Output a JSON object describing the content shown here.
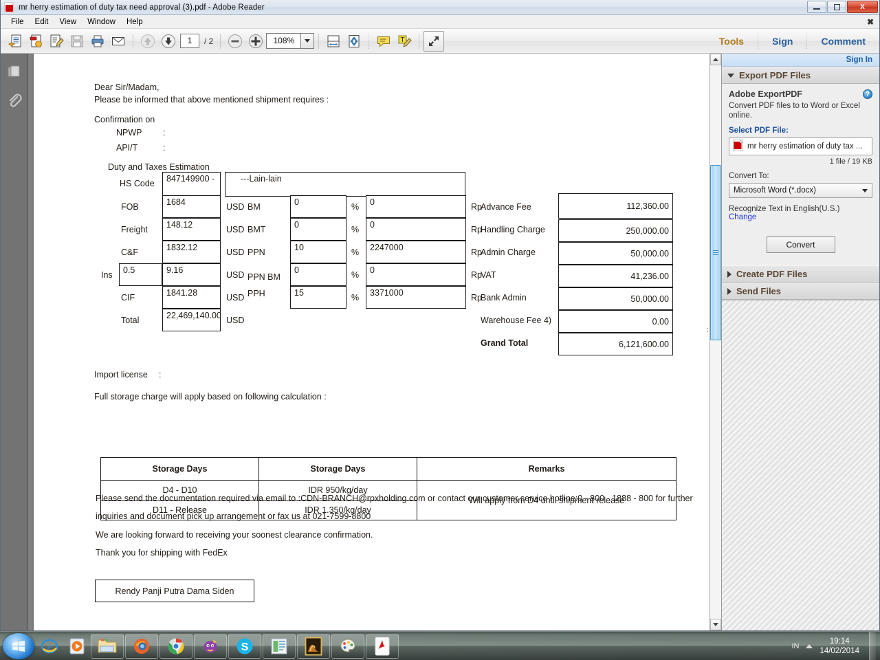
{
  "window": {
    "title": "mr herry estimation of duty tax need approval (3).pdf - Adobe Reader",
    "app_icon": "pdf-icon",
    "minimize_label": "Minimize",
    "restore_label": "Restore",
    "close_label": "X"
  },
  "menubar": {
    "items": [
      "File",
      "Edit",
      "View",
      "Window",
      "Help"
    ],
    "close_doc_label": "✖"
  },
  "toolbar": {
    "icons": [
      {
        "name": "open-file-icon",
        "glyph": "open"
      },
      {
        "name": "create-pdf-icon",
        "glyph": "create"
      },
      {
        "name": "edit-pdf-icon",
        "glyph": "edit"
      },
      {
        "name": "save-icon",
        "glyph": "save"
      },
      {
        "name": "print-icon",
        "glyph": "print"
      },
      {
        "name": "email-icon",
        "glyph": "email"
      }
    ],
    "prev_page_label": "Previous page",
    "next_page_label": "Next page",
    "page_number": "1",
    "page_total": "/ 2",
    "zoom_out_label": "Zoom out",
    "zoom_in_label": "Zoom in",
    "zoom_value": "108%",
    "fit_width_label": "Fit width",
    "fit_page_label": "Fit page",
    "comment_icon_label": "Sticky note",
    "highlight_icon_label": "Highlight text",
    "fullscreen_label": "Read mode",
    "tools_label": "Tools",
    "sign_label": "Sign",
    "comment_label": "Comment"
  },
  "left_nav": {
    "pages_label": "Page Thumbnails",
    "attachments_label": "Attachments"
  },
  "document": {
    "salutation": "Dear Sir/Madam,",
    "intro": "Please be informed that above mentioned shipment requires :",
    "confirmation_heading": "Confirmation on",
    "confirmation_rows": [
      {
        "label": "NPWP",
        "colon": ":",
        "value": ""
      },
      {
        "label": "API/T",
        "colon": ":",
        "value": ""
      }
    ],
    "duty_heading": "Duty and Taxes Estimation",
    "hs_code_label": "HS Code",
    "hs_code_value": "847149900 -",
    "hs_code_desc": "---Lain-lain",
    "left_rows": [
      {
        "label": "FOB",
        "value": "1684",
        "unit": "USD"
      },
      {
        "label": "Freight",
        "value": "148.12",
        "unit": "USD"
      },
      {
        "label": "C&F",
        "value": "1832.12",
        "unit": "USD"
      },
      {
        "label": "0.5",
        "value": "9.16",
        "unit": "USD",
        "prefix": "Ins"
      },
      {
        "label": "CIF",
        "value": "1841.28",
        "unit": "USD"
      },
      {
        "label": "Total",
        "value": "22,469,140.00",
        "unit": "USD"
      }
    ],
    "tax_rows": [
      {
        "label": "BM",
        "percent": "0",
        "pct_sym": "%",
        "amount": "0",
        "currency": "Rp"
      },
      {
        "label": "BMT",
        "percent": "0",
        "pct_sym": "%",
        "amount": "0",
        "currency": "Rp"
      },
      {
        "label": "PPN",
        "percent": "10",
        "pct_sym": "%",
        "amount": "2247000",
        "currency": "Rp"
      },
      {
        "label": "PPN BM",
        "percent": "0",
        "pct_sym": "%",
        "amount": "0",
        "currency": "Rp"
      },
      {
        "label": "PPH",
        "percent": "15",
        "pct_sym": "%",
        "amount": "3371000",
        "currency": "Rp"
      }
    ],
    "fee_rows": [
      {
        "label": "Advance Fee",
        "value": "112,360.00"
      },
      {
        "label": "Handling Charge",
        "value": "250,000.00"
      },
      {
        "label": "Admin Charge",
        "value": "50,000.00"
      },
      {
        "label": "VAT",
        "value": "41,236.00"
      },
      {
        "label": "Bank Admin",
        "value": "50,000.00"
      },
      {
        "label": "Warehouse Fee 4)",
        "value": "0.00"
      },
      {
        "label": "Grand Total",
        "value": "6,121,600.00",
        "bold": true
      }
    ],
    "stray_colon": ":",
    "import_license_label": "Import license",
    "import_license_colon": ":",
    "storage_intro": "Full storage charge will apply based on following calculation :",
    "storage_table": {
      "headers": [
        "Storage Days",
        "Storage Days",
        "Remarks"
      ],
      "rows": [
        {
          "days": "D4 - D10",
          "rate": "IDR 950/kg/day"
        },
        {
          "days": "D11 - Release",
          "rate": "IDR 1.350/kg/day"
        }
      ],
      "remarks": "Will apply from D4 until shipment release"
    },
    "closing_lines": [
      "Please send the documentation required via email to :CDN-BRANCH@rpxholding.com or contact our customer service hotline:0 - 800 - 1888 - 800 for further",
      "inquiries and document pick up arrangement or fax us at 021-7599-8800",
      "We are looking forward to receiving your soonest clearance confirmation.",
      "Thank you for shipping with FedEx"
    ],
    "signature_name": "Rendy Panji Putra Dama Siden"
  },
  "right_panel": {
    "sign_in_label": "Sign In",
    "sections": [
      {
        "title": "Export PDF Files",
        "expanded": true
      },
      {
        "title": "Create PDF Files",
        "expanded": false
      },
      {
        "title": "Send Files",
        "expanded": false
      }
    ],
    "export": {
      "product_title": "Adobe ExportPDF",
      "help_glyph": "?",
      "description": "Convert PDF files to to Word or Excel online.",
      "select_file_label": "Select PDF File:",
      "file_name": "mr herry estimation of duty tax ...",
      "file_meta": "1 file / 19 KB",
      "convert_to_label": "Convert To:",
      "convert_to_value": "Microsoft Word (*.docx)",
      "recognize_text": "Recognize Text in English(U.S.)",
      "change_link": "Change",
      "convert_button": "Convert"
    }
  },
  "scrollbar": {
    "up_label": "Scroll up",
    "down_label": "Scroll down",
    "thumb_label": "Vertical scroll thumb"
  },
  "taskbar": {
    "start_label": "Start",
    "quick_launch": [
      {
        "name": "internet-explorer-icon"
      },
      {
        "name": "windows-media-player-icon"
      }
    ],
    "tasks": [
      {
        "name": "file-explorer-icon"
      },
      {
        "name": "firefox-icon"
      },
      {
        "name": "chrome-icon"
      },
      {
        "name": "yahoo-messenger-icon"
      },
      {
        "name": "skype-icon"
      },
      {
        "name": "powerpoint-icon"
      },
      {
        "name": "photo-viewer-icon"
      },
      {
        "name": "paint-icon"
      },
      {
        "name": "adobe-reader-icon"
      }
    ],
    "language": "IN",
    "time": "19:14",
    "date": "14/02/2014"
  },
  "colors": {
    "accent_blue": "#2b5f9e",
    "tools_orange": "#b07a1e",
    "panel_header_text": "#5a4634",
    "link_blue": "#1b31d8",
    "scrollbar_thumb": "#a9d6f5"
  }
}
